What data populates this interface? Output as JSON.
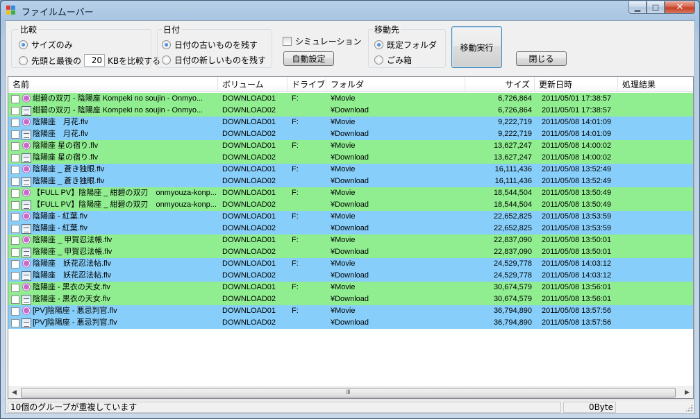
{
  "window": {
    "title": "ファイルムーバー",
    "controls": {
      "minimize": "▁",
      "maximize": "□",
      "close": "✕"
    }
  },
  "compare": {
    "title": "比較",
    "option_size_only": "サイズのみ",
    "option_head_tail_prefix": "先頭と最後の",
    "kb_value": "20",
    "option_head_tail_suffix": "KBを比較する",
    "selected": "size_only"
  },
  "date_group": {
    "title": "日付",
    "option_keep_old": "日付の古いものを残す",
    "option_keep_new": "日付の新しいものを残す",
    "selected": "keep_old"
  },
  "simulation": {
    "label": "シミュレーション",
    "checked": false
  },
  "auto_setting_button": "自動設定",
  "destination": {
    "title": "移動先",
    "option_default_folder": "既定フォルダ",
    "option_trash": "ごみ箱",
    "selected": "default_folder"
  },
  "execute_button": "移動実行",
  "close_button": "閉じる",
  "list": {
    "columns": [
      "名前",
      "ボリューム",
      "ドライブ",
      "フォルダ",
      "サイズ",
      "更新日時",
      "処理結果"
    ],
    "rows": [
      {
        "name": "紺碧の双刃 - 陰陽座 Kompeki no soujin - Onmyo...",
        "volume": "DOWNLOAD01",
        "drive": "F:",
        "folder": "¥Movie",
        "size": "6,726,864",
        "date": "2011/05/01 17:38:57",
        "result": "",
        "icon": "movie-icon",
        "color": "#90ee90"
      },
      {
        "name": "紺碧の双刃 - 陰陽座 Kompeki no soujin - Onmyo...",
        "volume": "DOWNLOAD02",
        "drive": "",
        "folder": "¥Download",
        "size": "6,726,864",
        "date": "2011/05/01 17:38:57",
        "result": "",
        "icon": "file-icon",
        "color": "#90ee90"
      },
      {
        "name": "陰陽座　月花.flv",
        "volume": "DOWNLOAD01",
        "drive": "F:",
        "folder": "¥Movie",
        "size": "9,222,719",
        "date": "2011/05/08 14:01:09",
        "result": "",
        "icon": "movie-icon",
        "color": "#87cefa"
      },
      {
        "name": "陰陽座　月花.flv",
        "volume": "DOWNLOAD02",
        "drive": "",
        "folder": "¥Download",
        "size": "9,222,719",
        "date": "2011/05/08 14:01:09",
        "result": "",
        "icon": "file-icon",
        "color": "#87cefa"
      },
      {
        "name": "陰陽座 星の宿り.flv",
        "volume": "DOWNLOAD01",
        "drive": "F:",
        "folder": "¥Movie",
        "size": "13,627,247",
        "date": "2011/05/08 14:00:02",
        "result": "",
        "icon": "movie-icon",
        "color": "#90ee90"
      },
      {
        "name": "陰陽座 星の宿り.flv",
        "volume": "DOWNLOAD02",
        "drive": "",
        "folder": "¥Download",
        "size": "13,627,247",
        "date": "2011/05/08 14:00:02",
        "result": "",
        "icon": "file-icon",
        "color": "#90ee90"
      },
      {
        "name": "陰陽座 _ 蒼き独眼.flv",
        "volume": "DOWNLOAD01",
        "drive": "F:",
        "folder": "¥Movie",
        "size": "16,111,436",
        "date": "2011/05/08 13:52:49",
        "result": "",
        "icon": "movie-icon",
        "color": "#87cefa"
      },
      {
        "name": "陰陽座 _ 蒼き独眼.flv",
        "volume": "DOWNLOAD02",
        "drive": "",
        "folder": "¥Download",
        "size": "16,111,436",
        "date": "2011/05/08 13:52:49",
        "result": "",
        "icon": "file-icon",
        "color": "#87cefa"
      },
      {
        "name": "【FULL PV】陰陽座 _ 紺碧の双刃　onmyouza-konp...",
        "volume": "DOWNLOAD01",
        "drive": "F:",
        "folder": "¥Movie",
        "size": "18,544,504",
        "date": "2011/05/08 13:50:49",
        "result": "",
        "icon": "movie-icon",
        "color": "#90ee90"
      },
      {
        "name": "【FULL PV】陰陽座 _ 紺碧の双刃　onmyouza-konp...",
        "volume": "DOWNLOAD02",
        "drive": "",
        "folder": "¥Download",
        "size": "18,544,504",
        "date": "2011/05/08 13:50:49",
        "result": "",
        "icon": "file-icon",
        "color": "#90ee90"
      },
      {
        "name": "陰陽座 - 紅葉.flv",
        "volume": "DOWNLOAD01",
        "drive": "F:",
        "folder": "¥Movie",
        "size": "22,652,825",
        "date": "2011/05/08 13:53:59",
        "result": "",
        "icon": "movie-icon",
        "color": "#87cefa"
      },
      {
        "name": "陰陽座 - 紅葉.flv",
        "volume": "DOWNLOAD02",
        "drive": "",
        "folder": "¥Download",
        "size": "22,652,825",
        "date": "2011/05/08 13:53:59",
        "result": "",
        "icon": "file-icon",
        "color": "#87cefa"
      },
      {
        "name": "陰陽座 _ 甲賀忍法帳.flv",
        "volume": "DOWNLOAD01",
        "drive": "F:",
        "folder": "¥Movie",
        "size": "22,837,090",
        "date": "2011/05/08 13:50:01",
        "result": "",
        "icon": "movie-icon",
        "color": "#90ee90"
      },
      {
        "name": "陰陽座 _ 甲賀忍法帳.flv",
        "volume": "DOWNLOAD02",
        "drive": "",
        "folder": "¥Download",
        "size": "22,837,090",
        "date": "2011/05/08 13:50:01",
        "result": "",
        "icon": "file-icon",
        "color": "#90ee90"
      },
      {
        "name": "陰陽座　妖花忍法帖.flv",
        "volume": "DOWNLOAD01",
        "drive": "F:",
        "folder": "¥Movie",
        "size": "24,529,778",
        "date": "2011/05/08 14:03:12",
        "result": "",
        "icon": "movie-icon",
        "color": "#87cefa"
      },
      {
        "name": "陰陽座　妖花忍法帖.flv",
        "volume": "DOWNLOAD02",
        "drive": "",
        "folder": "¥Download",
        "size": "24,529,778",
        "date": "2011/05/08 14:03:12",
        "result": "",
        "icon": "file-icon",
        "color": "#87cefa"
      },
      {
        "name": "陰陽座 - 黒衣の天女.flv",
        "volume": "DOWNLOAD01",
        "drive": "F:",
        "folder": "¥Movie",
        "size": "30,674,579",
        "date": "2011/05/08 13:56:01",
        "result": "",
        "icon": "movie-icon",
        "color": "#90ee90"
      },
      {
        "name": "陰陽座 - 黒衣の天女.flv",
        "volume": "DOWNLOAD02",
        "drive": "",
        "folder": "¥Download",
        "size": "30,674,579",
        "date": "2011/05/08 13:56:01",
        "result": "",
        "icon": "file-icon",
        "color": "#90ee90"
      },
      {
        "name": "[PV]陰陽座 - 悪忌判官.flv",
        "volume": "DOWNLOAD01",
        "drive": "F:",
        "folder": "¥Movie",
        "size": "36,794,890",
        "date": "2011/05/08 13:57:56",
        "result": "",
        "icon": "movie-icon",
        "color": "#87cefa"
      },
      {
        "name": "[PV]陰陽座 - 悪忌判官.flv",
        "volume": "DOWNLOAD02",
        "drive": "",
        "folder": "¥Download",
        "size": "36,794,890",
        "date": "2011/05/08 13:57:56",
        "result": "",
        "icon": "file-icon",
        "color": "#87cefa"
      }
    ]
  },
  "scrollbar": {
    "left_arrow": "◀",
    "right_arrow": "▶",
    "grip": "Ⅲ"
  },
  "status": {
    "message": "10個のグループが重複しています",
    "size_total": "0Byte"
  }
}
